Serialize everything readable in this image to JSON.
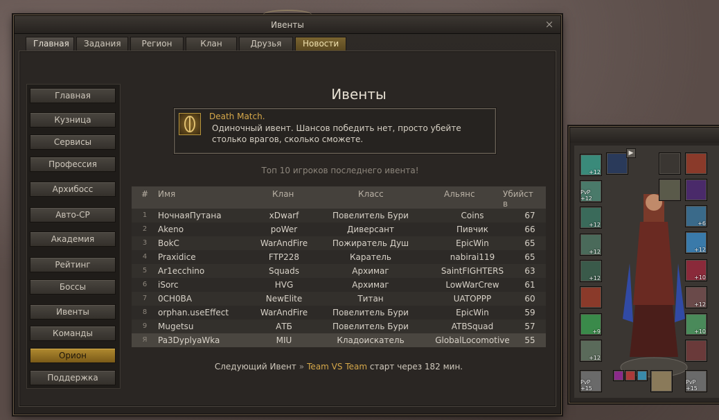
{
  "window": {
    "title": "Ивенты",
    "close_label": "×"
  },
  "tabs": [
    {
      "label": "Главная",
      "active": true
    },
    {
      "label": "Задания"
    },
    {
      "label": "Регион"
    },
    {
      "label": "Клан"
    },
    {
      "label": "Друзья"
    },
    {
      "label": "Новости",
      "highlight": true
    }
  ],
  "menu": [
    {
      "label": "Главная"
    },
    {
      "label": "Кузница"
    },
    {
      "label": "Сервисы"
    },
    {
      "label": "Профессия"
    },
    {
      "label": "Архибосс"
    },
    {
      "label": "Авто-СР"
    },
    {
      "label": "Академия"
    },
    {
      "label": "Рейтинг"
    },
    {
      "label": "Боссы"
    },
    {
      "label": "Ивенты"
    },
    {
      "label": "Команды"
    },
    {
      "label": "Орион",
      "active": true
    },
    {
      "label": "Поддержка"
    }
  ],
  "heading": "Ивенты",
  "event": {
    "title": "Death Match.",
    "description": "Одиночный ивент. Шансов победить нет, просто убейте столько врагов, сколько сможете."
  },
  "top_caption": "Топ 10 игроков последнего ивента!",
  "table": {
    "headers": {
      "num": "#",
      "name": "Имя",
      "clan": "Клан",
      "class": "Класс",
      "ally": "Альянс",
      "kills": "Убийств"
    },
    "rows": [
      {
        "num": "1",
        "name": "НочнаяПутана",
        "clan": "xDwarf",
        "class": "Повелитель Бури",
        "ally": "Coins",
        "kills": "67"
      },
      {
        "num": "2",
        "name": "Akeno",
        "clan": "poWer",
        "class": "Диверсант",
        "ally": "Пивчик",
        "kills": "66"
      },
      {
        "num": "3",
        "name": "BokC",
        "clan": "WarAndFire",
        "class": "Пожиратель Душ",
        "ally": "EpicWin",
        "kills": "65"
      },
      {
        "num": "4",
        "name": "Praxidice",
        "clan": "FTP228",
        "class": "Каратель",
        "ally": "nabirai119",
        "kills": "65"
      },
      {
        "num": "5",
        "name": "Ar1ecchino",
        "clan": "Squads",
        "class": "Архимаг",
        "ally": "SaintFIGHTERS",
        "kills": "63"
      },
      {
        "num": "6",
        "name": "iSorc",
        "clan": "HVG",
        "class": "Архимаг",
        "ally": "LowWarCrew",
        "kills": "61"
      },
      {
        "num": "7",
        "name": "0CH0BA",
        "clan": "NewElite",
        "class": "Титан",
        "ally": "UATOPPP",
        "kills": "60"
      },
      {
        "num": "8",
        "name": "orphan.useEffect",
        "clan": "WarAndFire",
        "class": "Повелитель Бури",
        "ally": "EpicWin",
        "kills": "59"
      },
      {
        "num": "9",
        "name": "Mugetsu",
        "clan": "АТБ",
        "class": "Повелитель Бури",
        "ally": "ATBSquad",
        "kills": "57"
      },
      {
        "num": "Я",
        "name": "Pa3DyplyaWka",
        "clan": "MIU",
        "class": "Кладоискатель",
        "ally": "GlobalLocomotive",
        "kills": "55",
        "me": true
      }
    ]
  },
  "next_event": {
    "prefix": "Следующий Ивент",
    "arrow": "»",
    "name": "Team VS Team",
    "suffix": "старт через 182 мин."
  },
  "equipment": {
    "arrow": "▶",
    "slot_levels": [
      "+12",
      "PvP +12",
      "+12",
      "+12",
      "+12",
      "+9",
      "+12",
      "PvP +15",
      "+6",
      "+12",
      "+10",
      "+12",
      "+10",
      "PvP +15"
    ]
  },
  "colors": {
    "accent_gold": "#d6a84a",
    "active_button": "#b08a30"
  }
}
